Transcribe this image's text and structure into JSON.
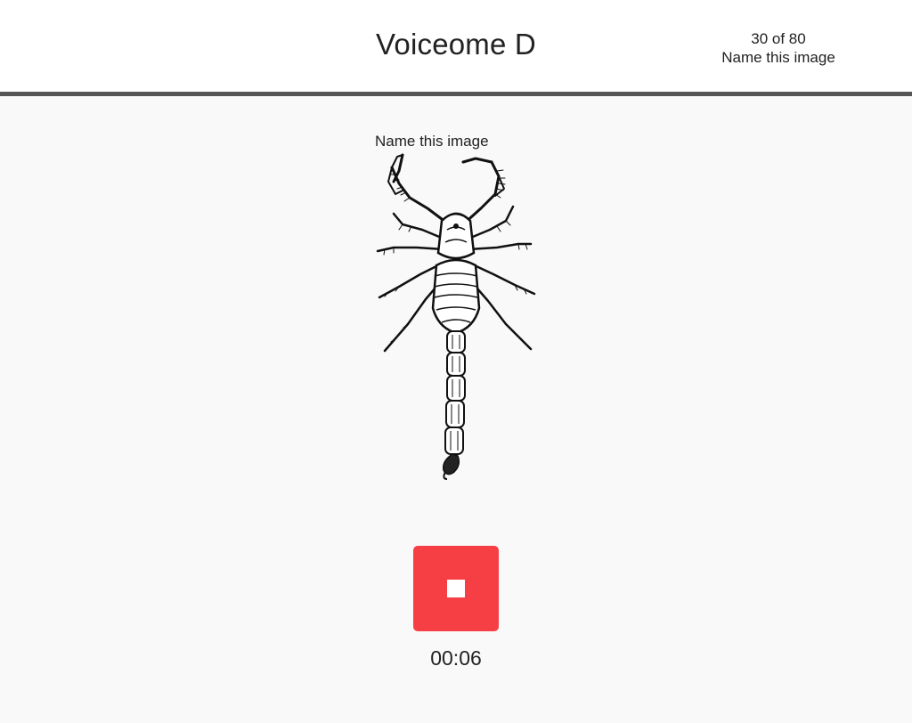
{
  "header": {
    "title": "Voiceome D",
    "progress": {
      "counter": "30 of 80",
      "task_name": "Name this image"
    }
  },
  "main": {
    "prompt": "Name this image",
    "stimulus_icon": "scorpion-illustration",
    "record_control": {
      "icon": "stop-icon",
      "color": "#f63f44"
    },
    "timer": "00:06"
  },
  "colors": {
    "header_background": "#ffffff",
    "header_border": "#555555",
    "page_background": "#f9f9f9",
    "stop_button": "#f63f44"
  }
}
